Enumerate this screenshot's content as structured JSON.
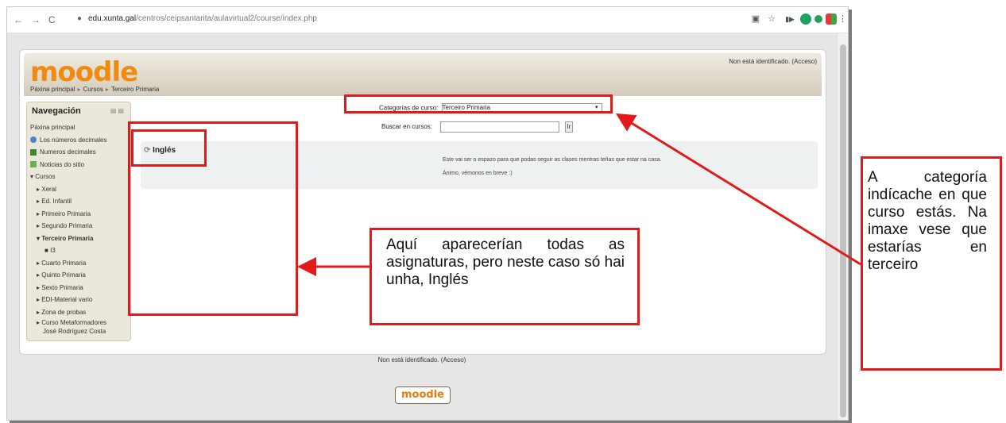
{
  "browser": {
    "back": "←",
    "forward": "→",
    "reload": "C",
    "lock": "🔒",
    "url_host": "edu.xunta.gal",
    "url_path": "/centros/ceipsantarita/aulavirtual2/course/index.php"
  },
  "header": {
    "logo": "moodle",
    "login_status": "Non está identificado. (Acceso)",
    "breadcrumb": [
      "Páxina principal",
      "Cursos",
      "Terceiro Primaria"
    ]
  },
  "navigation": {
    "title": "Navegación",
    "items": [
      {
        "label": "Páxina principal"
      },
      {
        "label": "Los números decimales"
      },
      {
        "label": "Numeros decimales"
      },
      {
        "label": "Noticias do sitio"
      },
      {
        "label": "Cursos"
      },
      {
        "label": "Xeral"
      },
      {
        "label": "Ed. Infantil"
      },
      {
        "label": "Primeiro Primaria"
      },
      {
        "label": "Segundo Primaria"
      },
      {
        "label": "Terceiro Primaria"
      },
      {
        "label": "I3"
      },
      {
        "label": "Cuarto Primaria"
      },
      {
        "label": "Quinto Primaria"
      },
      {
        "label": "Sexto Primaria"
      },
      {
        "label": "EDI-Material vario"
      },
      {
        "label": "Zona de probas"
      },
      {
        "label": "Curso Metaformadores"
      },
      {
        "label": "José Rodríguez Costa"
      }
    ]
  },
  "main": {
    "category_label": "Categorías de curso:",
    "category_value": "Terceiro Primaria",
    "search_label": "Buscar en cursos:",
    "search_button": "Ir",
    "course": {
      "name": "Inglés",
      "summary_1": "Este vai ser o espazo para que podas seguir as clases mentras teñas que estar na casa.",
      "summary_2": "Ánimo, vémonos en breve :)"
    }
  },
  "footer": {
    "login_status": "Non está identificado. (Acceso)",
    "logo": "moodle"
  },
  "annotations": {
    "courses_note": "Aquí aparecerían todas as asignaturas, pero neste caso só hai unha, Inglés",
    "category_note": "A categoría indícache en que curso estás. Na imaxe vese que estarías en terceiro"
  },
  "colors": {
    "annotation_red": "#e21a1a",
    "moodle_orange": "#f08a10"
  }
}
